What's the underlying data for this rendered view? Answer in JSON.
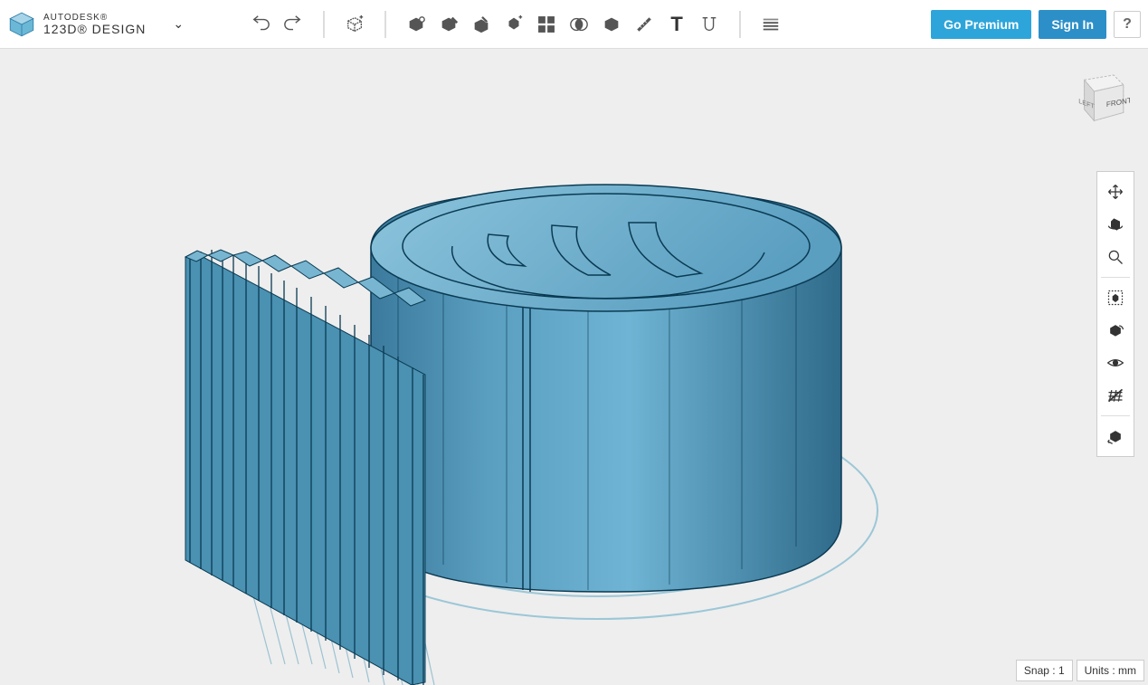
{
  "brand": "AUTODESK®",
  "app": "123D® DESIGN",
  "toolbar": {
    "undo": "undo",
    "redo": "redo",
    "primitive": "primitive",
    "sketch": "sketch",
    "modify": "modify",
    "pattern": "pattern",
    "group": "group",
    "combine": "combine",
    "measure": "measure",
    "construct": "construct",
    "transform": "transform",
    "text": "T",
    "snap": "snap",
    "material": "material"
  },
  "buttons": {
    "premium": "Go Premium",
    "signin": "Sign In",
    "help": "?"
  },
  "viewcube": {
    "left": "LEFT",
    "front": "FRONT"
  },
  "status": {
    "snap_label": "Snap :",
    "snap_value": "1",
    "units_label": "Units :",
    "units_value": "mm"
  },
  "nav": {
    "pan": "pan",
    "orbit": "orbit",
    "zoom": "zoom",
    "fit": "fit",
    "shaded": "shaded",
    "visibility": "visibility",
    "grid": "grid",
    "groundplane": "groundplane"
  }
}
